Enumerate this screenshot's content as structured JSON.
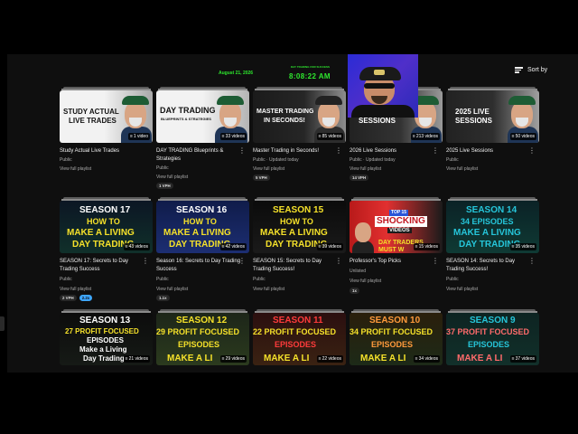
{
  "overlay": {
    "date": "August 21, 2026",
    "clock_caption": "DAY TRADING FOR SUCCESS",
    "time": "8:08:22 AM"
  },
  "toolbar": {
    "sort_label": "Sort by",
    "sort_icon": "sort-icon"
  },
  "colors": {
    "background": "#0f0f0f",
    "clock_green": "#2ee82e",
    "chip_blue": "#3ea6ff"
  },
  "playlists": [
    {
      "title": "Study Actual Live Trades",
      "meta": "Public",
      "link": "View full playlist",
      "count": "1 video",
      "thumb_lines": [
        "STUDY ACTUAL",
        "LIVE TRADES"
      ],
      "chips": []
    },
    {
      "title": "DAY TRADING Blueprints & Strategies",
      "meta": "Public",
      "link": "View full playlist",
      "count": "33 videos",
      "thumb_lines": [
        "DAY TRADING",
        "BLUEPRINTS & STRATEGIES"
      ],
      "chips": [
        "1 VPH"
      ]
    },
    {
      "title": "Master Trading in Seconds!",
      "meta": "Public · Updated today",
      "link": "View full playlist",
      "count": "85 videos",
      "thumb_lines": [
        "MASTER TRADING",
        "IN SECONDS!"
      ],
      "chips": [
        "5 VPH"
      ]
    },
    {
      "title": "2026 Live Sessions",
      "meta": "Public · Updated today",
      "link": "View full playlist",
      "count": "213 videos",
      "thumb_lines": [
        "SESSIONS"
      ],
      "chips": [
        "14 VPH"
      ]
    },
    {
      "title": "2025 Live Sessions",
      "meta": "Public",
      "link": "View full playlist",
      "count": "50 videos",
      "thumb_lines": [
        "2025 LIVE",
        "SESSIONS"
      ],
      "chips": []
    },
    {
      "title": "SEASON 17: Secrets to Day Trading Success",
      "meta": "Public",
      "link": "View full playlist",
      "count": "43 videos",
      "thumb_lines": [
        "SEASON 17",
        "HOW TO",
        "MAKE A LIVING",
        "DAY TRADING"
      ],
      "chips": [
        "2 VPH",
        "2.2x"
      ]
    },
    {
      "title": "Season 16: Secrets to Day Trading Success",
      "meta": "Public",
      "link": "View full playlist",
      "count": "42 videos",
      "thumb_lines": [
        "SEASON 16",
        "HOW TO",
        "MAKE A LIVING",
        "DAY TRADING"
      ],
      "chips": [
        "1.1x"
      ]
    },
    {
      "title": "SEASON 15: Secrets to Day Trading Success!",
      "meta": "Public",
      "link": "View full playlist",
      "count": "39 videos",
      "thumb_lines": [
        "SEASON 15",
        "HOW TO",
        "MAKE A LIVING",
        "DAY TRADING"
      ],
      "chips": []
    },
    {
      "title": "Professor's Top Picks",
      "meta": "Unlisted",
      "link": "View full playlist",
      "count": "15 videos",
      "thumb_lines": [
        "TOP 15",
        "SHOCKING",
        "VIDEOS",
        "DAY TRADERS",
        "MUST W"
      ],
      "chips": [
        "1x"
      ]
    },
    {
      "title": "SEASON 14: Secrets to Day Trading Success!",
      "meta": "Public",
      "link": "View full playlist",
      "count": "35 videos",
      "thumb_lines": [
        "SEASON 14",
        "34 EPISODES",
        "MAKE A LIVING",
        "DAY TRADING"
      ],
      "chips": []
    },
    {
      "title": "",
      "meta": "",
      "link": "",
      "count": "21 videos",
      "thumb_lines": [
        "SEASON 13",
        "27 PROFIT FOCUSED",
        "EPISODES",
        "Make a Living",
        "Day Trading"
      ],
      "chips": []
    },
    {
      "title": "",
      "meta": "",
      "link": "",
      "count": "29 videos",
      "thumb_lines": [
        "SEASON 12",
        "29 PROFIT FOCUSED",
        "EPISODES",
        "MAKE A LI"
      ],
      "chips": []
    },
    {
      "title": "",
      "meta": "",
      "link": "",
      "count": "22 videos",
      "thumb_lines": [
        "SEASON 11",
        "22 PROFIT FOCUSED",
        "EPISODES",
        "MAKE A LI"
      ],
      "chips": []
    },
    {
      "title": "",
      "meta": "",
      "link": "",
      "count": "34 videos",
      "thumb_lines": [
        "SEASON 10",
        "34 PROFIT FOCUSED",
        "EPISODES",
        "MAKE A LI"
      ],
      "chips": []
    },
    {
      "title": "",
      "meta": "",
      "link": "",
      "count": "37 videos",
      "thumb_lines": [
        "SEASON 9",
        "37 PROFIT FOCUSED",
        "EPISODES",
        "MAKE A LI"
      ],
      "chips": []
    }
  ]
}
